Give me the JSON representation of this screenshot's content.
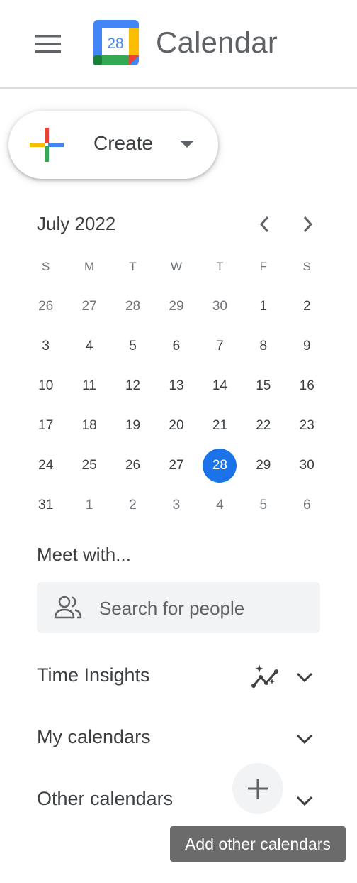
{
  "header": {
    "title": "Calendar",
    "logo_day": "28",
    "menu_icon": "hamburger-menu-icon"
  },
  "create": {
    "label": "Create"
  },
  "mini_calendar": {
    "month_label": "July 2022",
    "weekdays": [
      "S",
      "M",
      "T",
      "W",
      "T",
      "F",
      "S"
    ],
    "weeks": [
      [
        {
          "d": "26",
          "other": true
        },
        {
          "d": "27",
          "other": true
        },
        {
          "d": "28",
          "other": true
        },
        {
          "d": "29",
          "other": true
        },
        {
          "d": "30",
          "other": true
        },
        {
          "d": "1"
        },
        {
          "d": "2"
        }
      ],
      [
        {
          "d": "3"
        },
        {
          "d": "4"
        },
        {
          "d": "5"
        },
        {
          "d": "6"
        },
        {
          "d": "7"
        },
        {
          "d": "8"
        },
        {
          "d": "9"
        }
      ],
      [
        {
          "d": "10"
        },
        {
          "d": "11"
        },
        {
          "d": "12"
        },
        {
          "d": "13"
        },
        {
          "d": "14"
        },
        {
          "d": "15"
        },
        {
          "d": "16"
        }
      ],
      [
        {
          "d": "17"
        },
        {
          "d": "18"
        },
        {
          "d": "19"
        },
        {
          "d": "20"
        },
        {
          "d": "21"
        },
        {
          "d": "22"
        },
        {
          "d": "23"
        }
      ],
      [
        {
          "d": "24"
        },
        {
          "d": "25"
        },
        {
          "d": "26"
        },
        {
          "d": "27"
        },
        {
          "d": "28",
          "today": true
        },
        {
          "d": "29"
        },
        {
          "d": "30"
        }
      ],
      [
        {
          "d": "31"
        },
        {
          "d": "1",
          "other": true
        },
        {
          "d": "2",
          "other": true
        },
        {
          "d": "3",
          "other": true
        },
        {
          "d": "4",
          "other": true
        },
        {
          "d": "5",
          "other": true
        },
        {
          "d": "6",
          "other": true
        }
      ]
    ],
    "today_color": "#1a73e8"
  },
  "meet": {
    "title": "Meet with...",
    "search_placeholder": "Search for people"
  },
  "sections": {
    "time_insights": "Time Insights",
    "my_calendars": "My calendars",
    "other_calendars": "Other calendars"
  },
  "tooltip": {
    "text": "Add other calendars"
  },
  "colors": {
    "accent": "#1a73e8",
    "google_blue": "#4285f4",
    "google_red": "#ea4335",
    "google_yellow": "#fbbc04",
    "google_green": "#34a853"
  }
}
